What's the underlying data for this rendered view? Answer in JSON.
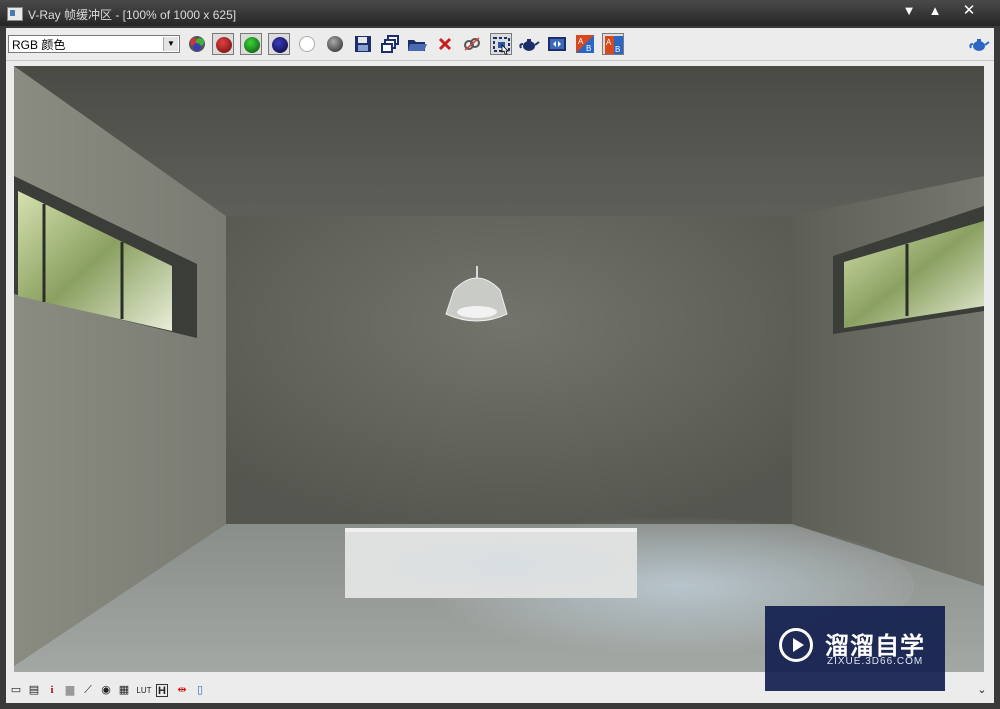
{
  "window": {
    "title": "V-Ray 帧缓冲区 - [100% of 1000 x 625]",
    "controls": {
      "minimize": "▼",
      "maximize": "▲",
      "close": "✕"
    }
  },
  "toolbar": {
    "channel_value": "RGB 颜色",
    "buttons": [
      {
        "name": "switch-to-rgb",
        "icon": "rgb-sphere-icon"
      },
      {
        "name": "view-red-channel",
        "icon": "red-channel-icon",
        "color": "#a01818"
      },
      {
        "name": "view-green-channel",
        "icon": "green-channel-icon",
        "color": "#119a11"
      },
      {
        "name": "view-blue-channel",
        "icon": "blue-channel-icon",
        "color": "#14146e"
      },
      {
        "name": "view-alpha-channel",
        "icon": "white-circle-icon",
        "color": "#ffffff"
      },
      {
        "name": "monochromatic",
        "icon": "mono-sphere-icon",
        "color": "#555555"
      },
      {
        "name": "save-image",
        "icon": "floppy-icon"
      },
      {
        "name": "clone-frame-buffer",
        "icon": "clone-icon"
      },
      {
        "name": "load-image",
        "icon": "folder-icon"
      },
      {
        "name": "clear-image",
        "icon": "red-x-icon"
      },
      {
        "name": "track-mouse",
        "icon": "link-icon"
      },
      {
        "name": "region-render",
        "icon": "region-icon"
      },
      {
        "name": "render-last",
        "icon": "teapot-icon"
      },
      {
        "name": "show-vfb-history",
        "icon": "history-icon"
      },
      {
        "name": "ab-compare-horizontal",
        "icon": "ab-horizontal-icon"
      },
      {
        "name": "ab-compare-vertical",
        "icon": "ab-vertical-icon"
      }
    ],
    "right_icon": "teapot-icon"
  },
  "status_icons": [
    "display-correction-icon",
    "pixel-info-icon",
    "info-icon",
    "levels-icon",
    "curves-icon",
    "color-wheel-icon",
    "exposure-icon",
    "lut-icon",
    "histogram-icon",
    "stereo-icon",
    "ocio-icon"
  ],
  "status_labels": {
    "info": "i",
    "lut": "LUT",
    "histogram": "H"
  },
  "scroll_icon": "double-chevron-down-icon",
  "watermark": {
    "brand": "溜溜自学",
    "site": "ZIXUE.3D66.COM"
  },
  "colors": {
    "accent": "#1f2f63"
  }
}
